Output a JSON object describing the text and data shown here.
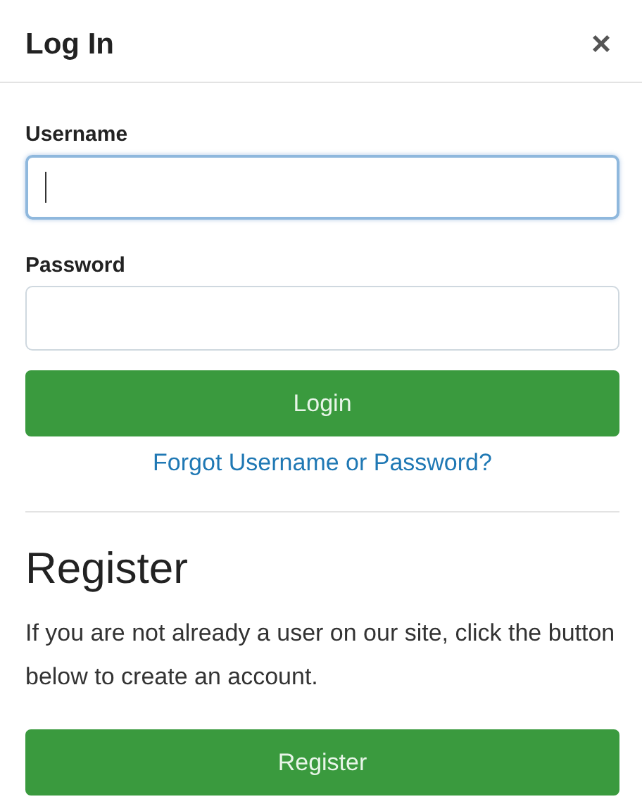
{
  "header": {
    "title": "Log In",
    "close": "×"
  },
  "fields": [
    {
      "label": "Username",
      "focused": true
    },
    {
      "label": "Password",
      "focused": false
    }
  ],
  "login_button": "Login",
  "forgot_link": "Forgot Username or Password?",
  "register": {
    "heading": "Register",
    "text": "If you are not already a user on our site, click the button below to create an account.",
    "button": "Register"
  }
}
